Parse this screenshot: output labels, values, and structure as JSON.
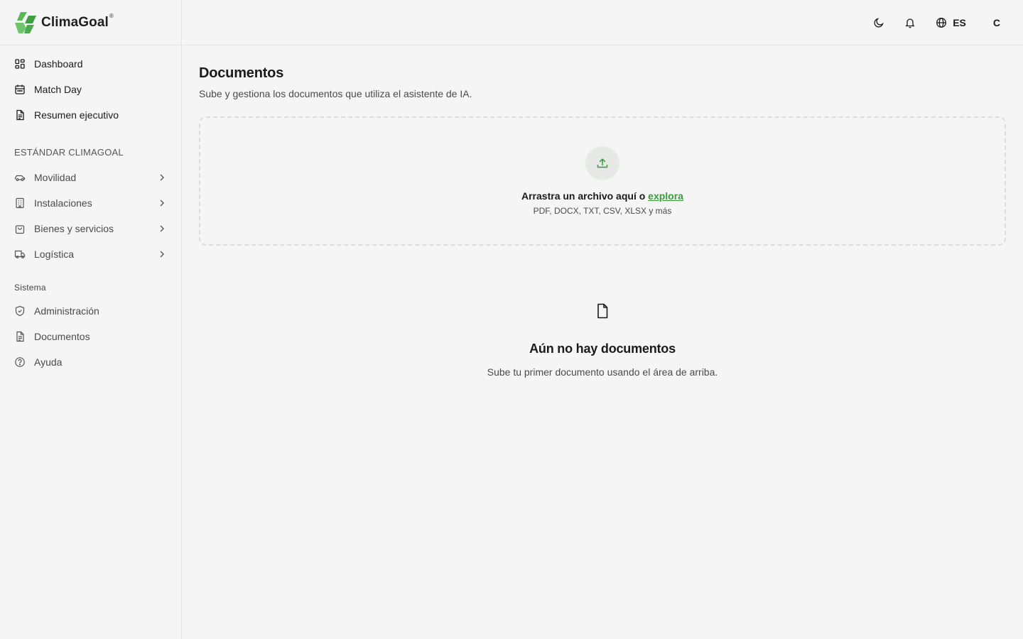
{
  "brand": {
    "name": "ClimaGoal",
    "reg": "®",
    "accent": "#4caf50"
  },
  "sidebar": {
    "top_items": [
      {
        "label": "Dashboard",
        "icon": "dashboard-grid-icon"
      },
      {
        "label": "Match Day",
        "icon": "calendar-icon"
      },
      {
        "label": "Resumen ejecutivo",
        "icon": "document-icon"
      }
    ],
    "standard_title": "ESTÁNDAR CLIMAGOAL",
    "standard_items": [
      {
        "label": "Movilidad",
        "icon": "car-icon"
      },
      {
        "label": "Instalaciones",
        "icon": "building-icon"
      },
      {
        "label": "Bienes y servicios",
        "icon": "shopping-bag-icon"
      },
      {
        "label": "Logística",
        "icon": "truck-icon"
      }
    ],
    "system_title": "Sistema",
    "system_items": [
      {
        "label": "Administración",
        "icon": "shield-icon"
      },
      {
        "label": "Documentos",
        "icon": "document-icon"
      },
      {
        "label": "Ayuda",
        "icon": "help-circle-icon"
      }
    ]
  },
  "topbar": {
    "language": "ES",
    "user_initial": "C"
  },
  "main": {
    "title": "Documentos",
    "subtitle": "Sube y gestiona los documentos que utiliza el asistente de IA.",
    "dropzone": {
      "text_prefix": "Arrastra un archivo aquí o ",
      "link": "explora",
      "formats": "PDF, DOCX, TXT, CSV, XLSX y más"
    },
    "empty": {
      "title": "Aún no hay documentos",
      "text": "Sube tu primer documento usando el área de arriba."
    }
  }
}
